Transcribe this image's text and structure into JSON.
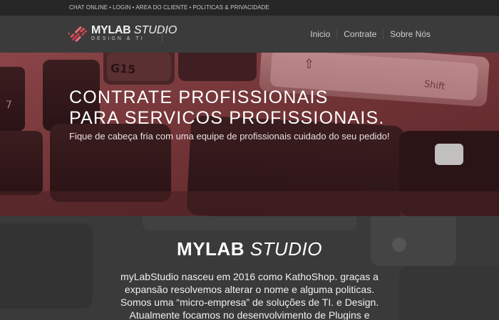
{
  "topbar": {
    "links": [
      "CHAT ONLINE",
      "LOGIN",
      "AREA DO CLIENTE",
      "POLITICAS & PRIVACIDADE"
    ],
    "separator": "•"
  },
  "brand": {
    "name_bold": "MYLAB",
    "name_italic": " STUDIO",
    "tagline": "DESIGN & TI",
    "accent_color": "#e04a5a"
  },
  "nav": {
    "items": [
      "Inicio",
      "Contrate",
      "Sobre Nós"
    ]
  },
  "hero": {
    "title_line1": "CONTRATE PROFISSIONAIS",
    "title_line2": "PARA SERVICOS PROFISSIONAIS.",
    "subtitle": "Fique de cabeça fria com uma equipe de profissionais cuidado do seu pedido!",
    "key_labels": [
      "G15",
      "Shift"
    ],
    "tint_color": "#7a3a3d"
  },
  "about": {
    "title_bold": "MYLAB",
    "title_italic": " STUDIO",
    "paragraph_lines": [
      "myLabStudio nasceu em 2016 como KathoShop. graças a",
      "expansão resolvemos alterar o nome e alguma politicas.",
      "Somos uma “micro-empresa” de soluções de TI. e Design.",
      "Atualmente focamos no desenvolvimento de Plugins e"
    ]
  }
}
